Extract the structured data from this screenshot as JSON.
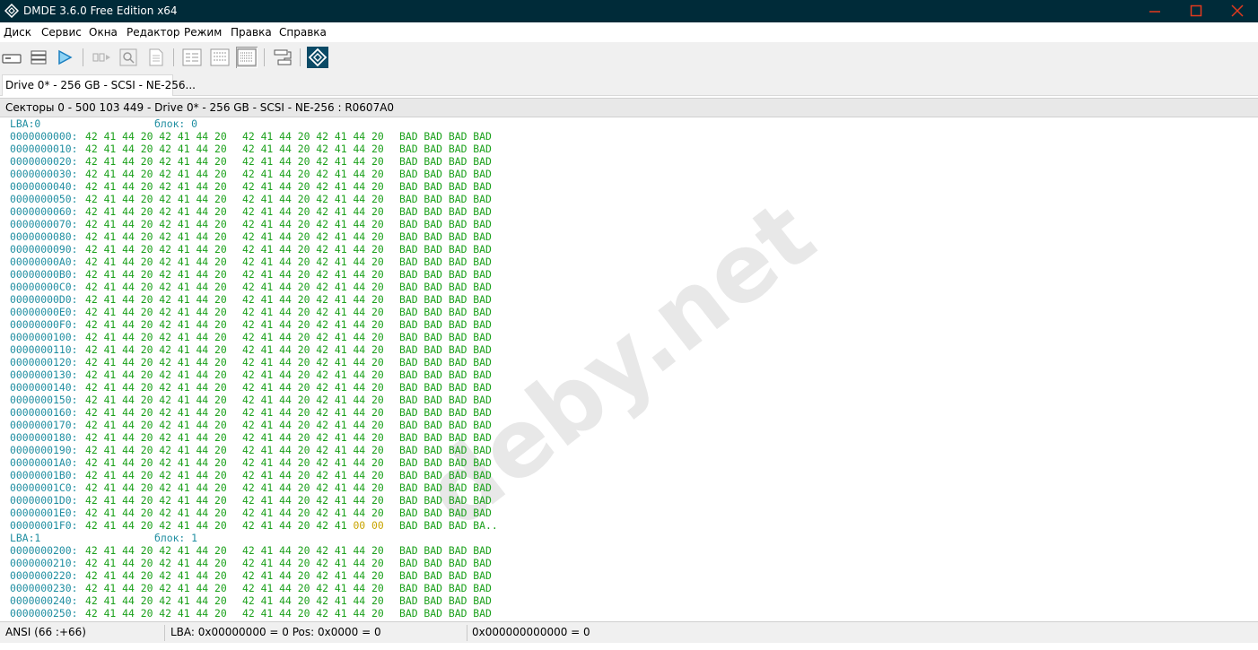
{
  "window": {
    "title": "DMDE 3.6.0 Free Edition x64",
    "title_bar_color": "#002b39",
    "controls": [
      "minimize-icon",
      "maximize-icon",
      "close-icon"
    ]
  },
  "menu": [
    {
      "label": "Диск"
    },
    {
      "label": "Сервис"
    },
    {
      "label": "Окна"
    },
    {
      "label": "Редактор"
    },
    {
      "label": "Режим"
    },
    {
      "label": "Правка"
    },
    {
      "label": "Справка"
    }
  ],
  "toolbar": {
    "icons": [
      "disk-icon",
      "partitions-icon",
      "play-icon",
      "sequence-icon",
      "search-icon",
      "document-icon",
      "view-hex-icon",
      "view-list-icon",
      "view-table-icon",
      "connections-icon",
      "dmde-logo-icon"
    ]
  },
  "tab": {
    "label": "Drive 0* - 256 GB - SCSI - NE-256..."
  },
  "infobar": {
    "text": "Секторы 0 - 500 103 449 - Drive 0* - 256 GB - SCSI - NE-256 : R0607A0"
  },
  "editor": {
    "colors": {
      "address": "#1f8ea1",
      "hex": "#1aa01a",
      "zero_bytes": "#c8a400",
      "cursor_bg": "#000000"
    },
    "sectors": [
      {
        "lba_label": "LBA:0",
        "block_label": "блок: 0",
        "rows": [
          {
            "addr": "0000000000:",
            "hex1": "42 41 44 20 42 41 44 20",
            "hex2": "42 41 44 20 42 41 44 20",
            "ascii": "BAD BAD BAD BAD"
          },
          {
            "addr": "0000000010:",
            "hex1": "42 41 44 20 42 41 44 20",
            "hex2": "42 41 44 20 42 41 44 20",
            "ascii": "BAD BAD BAD BAD"
          },
          {
            "addr": "0000000020:",
            "hex1": "42 41 44 20 42 41 44 20",
            "hex2": "42 41 44 20 42 41 44 20",
            "ascii": "BAD BAD BAD BAD"
          },
          {
            "addr": "0000000030:",
            "hex1": "42 41 44 20 42 41 44 20",
            "hex2": "42 41 44 20 42 41 44 20",
            "ascii": "BAD BAD BAD BAD"
          },
          {
            "addr": "0000000040:",
            "hex1": "42 41 44 20 42 41 44 20",
            "hex2": "42 41 44 20 42 41 44 20",
            "ascii": "BAD BAD BAD BAD"
          },
          {
            "addr": "0000000050:",
            "hex1": "42 41 44 20 42 41 44 20",
            "hex2": "42 41 44 20 42 41 44 20",
            "ascii": "BAD BAD BAD BAD"
          },
          {
            "addr": "0000000060:",
            "hex1": "42 41 44 20 42 41 44 20",
            "hex2": "42 41 44 20 42 41 44 20",
            "ascii": "BAD BAD BAD BAD"
          },
          {
            "addr": "0000000070:",
            "hex1": "42 41 44 20 42 41 44 20",
            "hex2": "42 41 44 20 42 41 44 20",
            "ascii": "BAD BAD BAD BAD"
          },
          {
            "addr": "0000000080:",
            "hex1": "42 41 44 20 42 41 44 20",
            "hex2": "42 41 44 20 42 41 44 20",
            "ascii": "BAD BAD BAD BAD"
          },
          {
            "addr": "0000000090:",
            "hex1": "42 41 44 20 42 41 44 20",
            "hex2": "42 41 44 20 42 41 44 20",
            "ascii": "BAD BAD BAD BAD"
          },
          {
            "addr": "00000000A0:",
            "hex1": "42 41 44 20 42 41 44 20",
            "hex2": "42 41 44 20 42 41 44 20",
            "ascii": "BAD BAD BAD BAD"
          },
          {
            "addr": "00000000B0:",
            "hex1": "42 41 44 20 42 41 44 20",
            "hex2": "42 41 44 20 42 41 44 20",
            "ascii": "BAD BAD BAD BAD"
          },
          {
            "addr": "00000000C0:",
            "hex1": "42 41 44 20 42 41 44 20",
            "hex2": "42 41 44 20 42 41 44 20",
            "ascii": "BAD BAD BAD BAD"
          },
          {
            "addr": "00000000D0:",
            "hex1": "42 41 44 20 42 41 44 20",
            "hex2": "42 41 44 20 42 41 44 20",
            "ascii": "BAD BAD BAD BAD"
          },
          {
            "addr": "00000000E0:",
            "hex1": "42 41 44 20 42 41 44 20",
            "hex2": "42 41 44 20 42 41 44 20",
            "ascii": "BAD BAD BAD BAD"
          },
          {
            "addr": "00000000F0:",
            "hex1": "42 41 44 20 42 41 44 20",
            "hex2": "42 41 44 20 42 41 44 20",
            "ascii": "BAD BAD BAD BAD"
          },
          {
            "addr": "0000000100:",
            "hex1": "42 41 44 20 42 41 44 20",
            "hex2": "42 41 44 20 42 41 44 20",
            "ascii": "BAD BAD BAD BAD"
          },
          {
            "addr": "0000000110:",
            "hex1": "42 41 44 20 42 41 44 20",
            "hex2": "42 41 44 20 42 41 44 20",
            "ascii": "BAD BAD BAD BAD"
          },
          {
            "addr": "0000000120:",
            "hex1": "42 41 44 20 42 41 44 20",
            "hex2": "42 41 44 20 42 41 44 20",
            "ascii": "BAD BAD BAD BAD"
          },
          {
            "addr": "0000000130:",
            "hex1": "42 41 44 20 42 41 44 20",
            "hex2": "42 41 44 20 42 41 44 20",
            "ascii": "BAD BAD BAD BAD"
          },
          {
            "addr": "0000000140:",
            "hex1": "42 41 44 20 42 41 44 20",
            "hex2": "42 41 44 20 42 41 44 20",
            "ascii": "BAD BAD BAD BAD"
          },
          {
            "addr": "0000000150:",
            "hex1": "42 41 44 20 42 41 44 20",
            "hex2": "42 41 44 20 42 41 44 20",
            "ascii": "BAD BAD BAD BAD"
          },
          {
            "addr": "0000000160:",
            "hex1": "42 41 44 20 42 41 44 20",
            "hex2": "42 41 44 20 42 41 44 20",
            "ascii": "BAD BAD BAD BAD"
          },
          {
            "addr": "0000000170:",
            "hex1": "42 41 44 20 42 41 44 20",
            "hex2": "42 41 44 20 42 41 44 20",
            "ascii": "BAD BAD BAD BAD"
          },
          {
            "addr": "0000000180:",
            "hex1": "42 41 44 20 42 41 44 20",
            "hex2": "42 41 44 20 42 41 44 20",
            "ascii": "BAD BAD BAD BAD"
          },
          {
            "addr": "0000000190:",
            "hex1": "42 41 44 20 42 41 44 20",
            "hex2": "42 41 44 20 42 41 44 20",
            "ascii": "BAD BAD BAD BAD"
          },
          {
            "addr": "00000001A0:",
            "hex1": "42 41 44 20 42 41 44 20",
            "hex2": "42 41 44 20 42 41 44 20",
            "ascii": "BAD BAD BAD BAD"
          },
          {
            "addr": "00000001B0:",
            "hex1": "42 41 44 20 42 41 44 20",
            "hex2": "42 41 44 20 42 41 44 20",
            "ascii": "BAD BAD BAD BAD"
          },
          {
            "addr": "00000001C0:",
            "hex1": "42 41 44 20 42 41 44 20",
            "hex2": "42 41 44 20 42 41 44 20",
            "ascii": "BAD BAD BAD BAD"
          },
          {
            "addr": "00000001D0:",
            "hex1": "42 41 44 20 42 41 44 20",
            "hex2": "42 41 44 20 42 41 44 20",
            "ascii": "BAD BAD BAD BAD"
          },
          {
            "addr": "00000001E0:",
            "hex1": "42 41 44 20 42 41 44 20",
            "hex2": "42 41 44 20 42 41 44 20",
            "ascii": "BAD BAD BAD BAD"
          },
          {
            "addr": "00000001F0:",
            "hex1": "42 41 44 20 42 41 44 20",
            "hex2": "42 41 44 20 42 41",
            "hex2_zero": "00 00",
            "ascii": "BAD BAD BAD BA.."
          }
        ]
      },
      {
        "lba_label": "LBA:1",
        "block_label": "блок: 1",
        "rows": [
          {
            "addr": "0000000200:",
            "hex1": "42 41 44 20 42 41 44 20",
            "hex2": "42 41 44 20 42 41 44 20",
            "ascii": "BAD BAD BAD BAD"
          },
          {
            "addr": "0000000210:",
            "hex1": "42 41 44 20 42 41 44 20",
            "hex2": "42 41 44 20 42 41 44 20",
            "ascii": "BAD BAD BAD BAD"
          },
          {
            "addr": "0000000220:",
            "hex1": "42 41 44 20 42 41 44 20",
            "hex2": "42 41 44 20 42 41 44 20",
            "ascii": "BAD BAD BAD BAD"
          },
          {
            "addr": "0000000230:",
            "hex1": "42 41 44 20 42 41 44 20",
            "hex2": "42 41 44 20 42 41 44 20",
            "ascii": "BAD BAD BAD BAD"
          },
          {
            "addr": "0000000240:",
            "hex1": "42 41 44 20 42 41 44 20",
            "hex2": "42 41 44 20 42 41 44 20",
            "ascii": "BAD BAD BAD BAD"
          },
          {
            "addr": "0000000250:",
            "hex1": "42 41 44 20 42 41 44 20",
            "hex2": "42 41 44 20 42 41 44 20",
            "ascii": "BAD BAD BAD BAD"
          }
        ]
      }
    ]
  },
  "watermark": "deby.net",
  "status": {
    "encoding": "ANSI (66 :+66)",
    "position": "LBA: 0x00000000 = 0  Pos: 0x0000 = 0",
    "value": "0x000000000000 = 0"
  }
}
